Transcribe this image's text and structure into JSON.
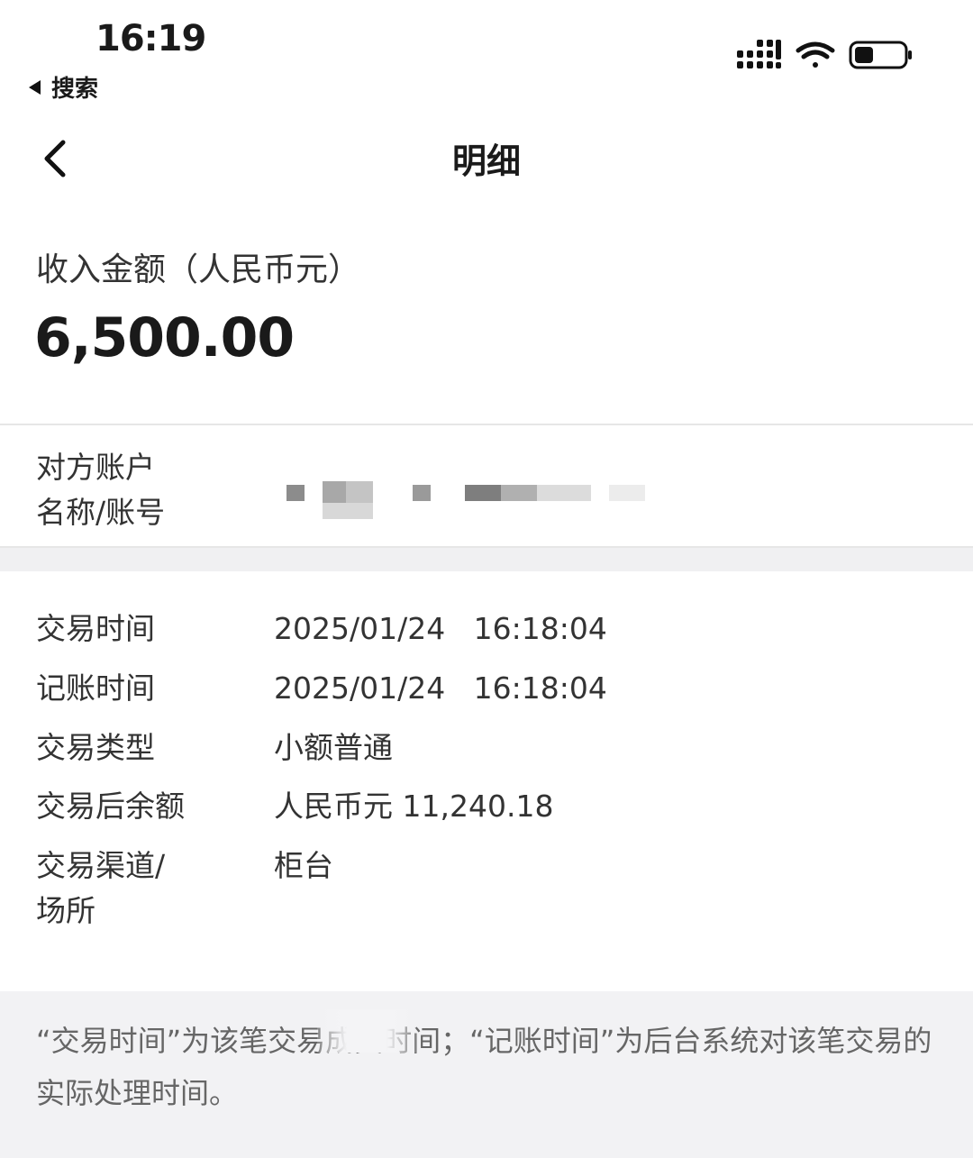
{
  "status_bar": {
    "time": "16:19",
    "back_app": "搜索"
  },
  "nav": {
    "title": "明细"
  },
  "amount": {
    "label": "收入金额（人民币元）",
    "value": "6,500.00"
  },
  "counterparty": {
    "label_line1": "对方账户",
    "label_line2": "名称/账号"
  },
  "details": [
    {
      "label": "交易时间",
      "value": "2025/01/24   16:18:04"
    },
    {
      "label": "记账时间",
      "value": "2025/01/24   16:18:04"
    },
    {
      "label": "交易类型",
      "value": "小额普通"
    },
    {
      "label": "交易后余额",
      "value": "人民币元 11,240.18"
    },
    {
      "label_line1": "交易渠道/",
      "label_line2": "场所",
      "value": "柜台"
    }
  ],
  "note": {
    "text": "“交易时间”为该笔交易成交时间；“记账时间”为后台系统对该笔交易的实际处理时间。"
  },
  "colors": {
    "text_primary": "#1a1a1a",
    "text_secondary": "#333333",
    "note_text": "#666666",
    "section_bg": "#f0f0f2"
  },
  "icons": [
    "signal-icon",
    "wifi-icon",
    "battery-icon",
    "back-arrow-icon"
  ]
}
